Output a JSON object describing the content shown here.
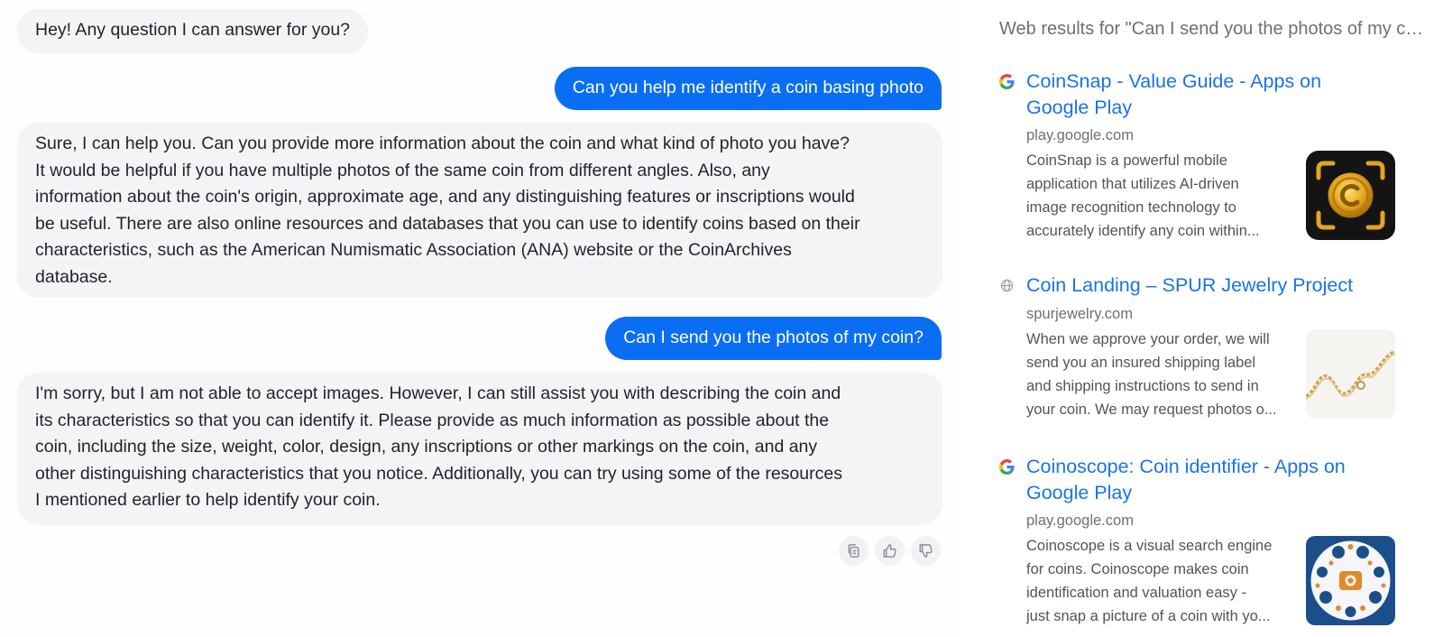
{
  "chat": {
    "messages": [
      {
        "role": "bot",
        "lines": [
          "Hey! Any question I can answer for you?"
        ]
      },
      {
        "role": "user",
        "lines": [
          "Can you help me identify a coin basing photo"
        ]
      },
      {
        "role": "bot",
        "lines": [
          "Sure, I can help you. Can you provide more information about the coin and what kind of photo you have?",
          "It would be helpful if you have multiple photos of the same coin from different angles. Also, any",
          "information about the coin's origin, approximate age, and any distinguishing features or inscriptions would",
          "be useful. There are also online resources and databases that you can use to identify coins based on their",
          "characteristics, such as the American Numismatic Association (ANA) website or the CoinArchives",
          "database."
        ]
      },
      {
        "role": "user",
        "lines": [
          "Can I send you the photos of my coin?"
        ]
      },
      {
        "role": "bot",
        "lines": [
          "I'm sorry, but I am not able to accept images. However, I can still assist you with describing the coin and",
          "its characteristics so that you can identify it. Please provide as much information as possible about the",
          "coin, including the size, weight, color, design, any inscriptions or other markings on the coin, and any",
          "other distinguishing characteristics that you notice. Additionally, you can try using some of the resources",
          "I mentioned earlier to help identify your coin."
        ]
      }
    ],
    "actions": [
      {
        "name": "copy-icon"
      },
      {
        "name": "thumbs-up-icon"
      },
      {
        "name": "thumbs-down-icon"
      }
    ]
  },
  "web_results": {
    "title": "Web results for \"Can I send you the photos of my coin?\"",
    "items": [
      {
        "favicon": "google-icon",
        "title_lines": [
          "CoinSnap - Value Guide - Apps on",
          "Google Play"
        ],
        "domain": "play.google.com",
        "snippet_lines": [
          "CoinSnap is a powerful mobile",
          "application that utilizes AI-driven",
          "image recognition technology to",
          "accurately identify any coin within..."
        ],
        "thumbnail": "coinsnap-app-icon"
      },
      {
        "favicon": "globe-icon",
        "title_lines": [
          "Coin Landing – SPUR Jewelry Project"
        ],
        "domain": "spurjewelry.com",
        "snippet_lines": [
          "When we approve your order, we will",
          "send you an insured shipping label",
          "and shipping instructions to send in",
          "your coin. We may request photos o..."
        ],
        "thumbnail": "gold-chain-photo"
      },
      {
        "favicon": "google-icon",
        "title_lines": [
          "Coinoscope: Coin identifier - Apps on",
          "Google Play"
        ],
        "domain": "play.google.com",
        "snippet_lines": [
          "Coinoscope is a visual search engine",
          "for coins. Coinoscope makes coin",
          "identification and valuation easy -",
          "just snap a picture of a coin with yo..."
        ],
        "thumbnail": "coinoscope-app-icon"
      }
    ]
  },
  "colors": {
    "user_bubble": "#0a6ef5",
    "bot_bubble": "#f3f4f6",
    "link": "#1a73e8"
  }
}
